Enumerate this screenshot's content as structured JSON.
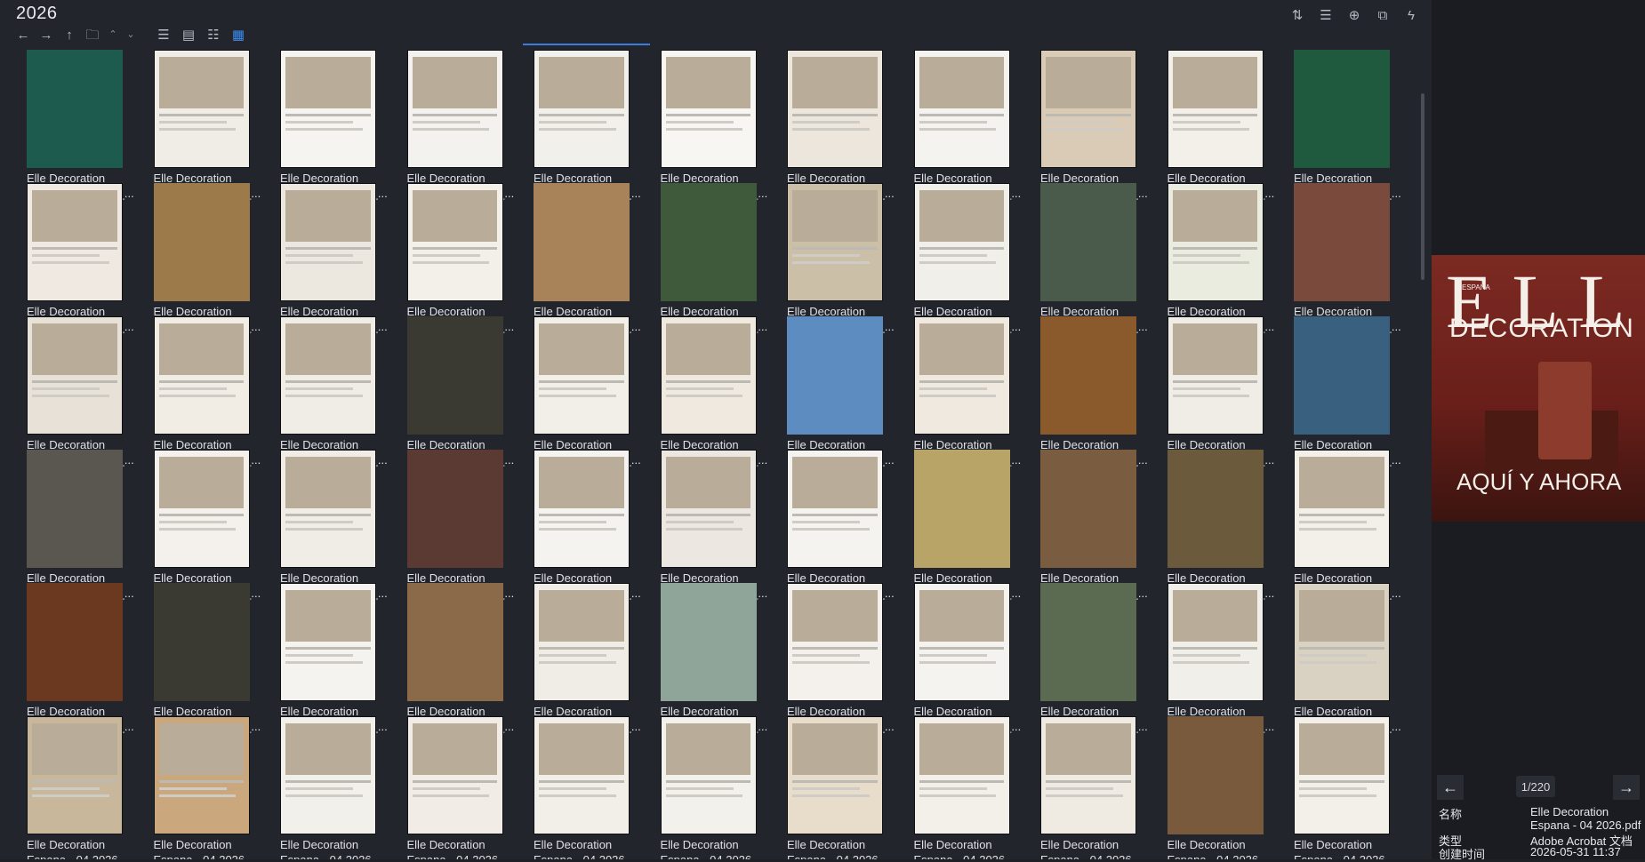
{
  "window": {
    "folder_title": "2026"
  },
  "nav": {
    "back_icon": "←",
    "forward_icon": "→",
    "up_icon": "↑",
    "folder_icon": "🗀",
    "caret_up": "⌃",
    "caret_down": "⌄",
    "view_icons": [
      "☰",
      "▤",
      "☷",
      "▦"
    ]
  },
  "toolbar_right": {
    "icons": [
      "⇅",
      "☰",
      "⊕",
      "⧉",
      "ϟ"
    ]
  },
  "thumbnails": {
    "caption_line1": "Elle Decoration",
    "caption_line2": "Espana - 04 2026_...",
    "rows": [
      [
        "#1d5b4e",
        "#f0ede6",
        "#f5f4f1",
        "#f3f2ee",
        "#f2f0ea",
        "#f7f6f3",
        "#ece6dd",
        "#f4f3f0",
        "#d9cbb5",
        "#f3f0ea",
        "#1f5a3e"
      ],
      [
        "#efe9e2",
        "#9c7a4a",
        "#ece7df",
        "#f3efe9",
        "#a8835a",
        "#3e5a3a",
        "#cbbfa7",
        "#f1efea",
        "#4a5a4b",
        "#e9ecdf",
        "#7a4b3c"
      ],
      [
        "#e8e1d8",
        "#f1ece4",
        "#f0ece6",
        "#3a3a32",
        "#f2eee8",
        "#efe9df",
        "#5c8cc0",
        "#efe9df",
        "#8a5a2c",
        "#f0ede6",
        "#3a6080"
      ],
      [
        "#5a5650",
        "#f4f1ec",
        "#f0ece6",
        "#5a3a32",
        "#f4f3f0",
        "#ece7e0",
        "#f4f3f0",
        "#b8a466",
        "#7a5c40",
        "#6b5a3c",
        "#f3f0ea"
      ],
      [
        "#6b3820",
        "#3a3a33",
        "#f4f3f0",
        "#8a6a48",
        "#f0ede6",
        "#8fa59a",
        "#f4f1ec",
        "#f4f3f0",
        "#5a6b52",
        "#f1efea",
        "#d9d2c2"
      ],
      [
        "#c9b79c",
        "#caa77c",
        "#f2f0ea",
        "#f1ede6",
        "#f2efe8",
        "#f3f1ec",
        "#e8dccb",
        "#f3f0ea",
        "#efeae2",
        "#7a5a3c",
        "#f3f0ea"
      ]
    ]
  },
  "preview": {
    "cover_title": "ELLE",
    "cover_edition": "ESPAÑA",
    "cover_subtitle": "DECORATION",
    "cover_headline": "AQUÍ Y AHORA",
    "prev_icon": "←",
    "next_icon": "→",
    "page_counter": "1/220",
    "info": [
      {
        "key": "名称",
        "value": "Elle Decoration"
      },
      {
        "key": "",
        "value": "Espana - 04 2026.pdf"
      },
      {
        "key": "类型",
        "value": "Adobe Acrobat 文档"
      },
      {
        "key": "创建时间",
        "value": "2026-05-31  11:37"
      }
    ]
  }
}
